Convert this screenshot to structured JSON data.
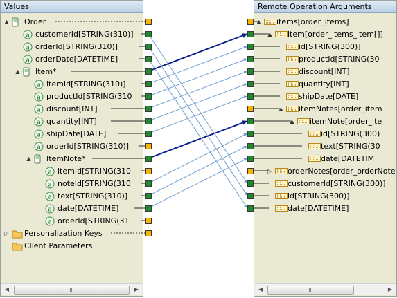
{
  "left": {
    "title": "Values",
    "rows": [
      {
        "label": "Order",
        "expander": "▲",
        "icon": "phone-icon",
        "port": "o",
        "dash": true
      },
      {
        "label": "customerId[STRING(310)]",
        "icon": "attribute-icon",
        "port": "g"
      },
      {
        "label": "orderId[STRING(310)]",
        "icon": "attribute-icon",
        "port": "g"
      },
      {
        "label": "orderDate[DATETIME]",
        "icon": "attribute-icon",
        "port": "g"
      },
      {
        "label": "Item*",
        "expander": "▲",
        "icon": "phone-icon",
        "port": "g"
      },
      {
        "label": "itemId[STRING(310)]",
        "icon": "attribute-icon",
        "port": "g"
      },
      {
        "label": "productId[STRING(310",
        "icon": "attribute-icon",
        "port": "g"
      },
      {
        "label": "discount[INT]",
        "icon": "attribute-icon",
        "port": "g"
      },
      {
        "label": "quantity[INT]",
        "icon": "attribute-icon",
        "port": "g"
      },
      {
        "label": "shipDate[DATE]",
        "icon": "attribute-icon",
        "port": "g"
      },
      {
        "label": "orderId[STRING(310)]",
        "icon": "attribute-icon",
        "port": "o"
      },
      {
        "label": "ItemNote*",
        "expander": "▲",
        "icon": "phone-icon",
        "port": "g"
      },
      {
        "label": "itemId[STRING(310",
        "icon": "attribute-icon",
        "port": "o"
      },
      {
        "label": "noteId[STRING(310",
        "icon": "attribute-icon",
        "port": "g"
      },
      {
        "label": "text[STRING(310)]",
        "icon": "attribute-icon",
        "port": "g"
      },
      {
        "label": "date[DATETIME]",
        "icon": "attribute-icon",
        "port": "g"
      },
      {
        "label": "orderId[STRING(31",
        "icon": "attribute-icon",
        "port": "o"
      },
      {
        "label": "Personalization Keys",
        "expander": "▷",
        "icon": "folder-icon",
        "port": "o",
        "dash": true
      },
      {
        "label": "Client Parameters",
        "icon": "folder-icon"
      }
    ]
  },
  "right": {
    "title": "Remote Operation Arguments",
    "rows": [
      {
        "label": "items[order_items]",
        "expander": "▲",
        "icon": "field-icon",
        "port": "o"
      },
      {
        "label": "item[order_items_item[]]",
        "expander": "▲",
        "icon": "field-icon",
        "port": "g"
      },
      {
        "label": "id[STRING(300)]",
        "icon": "field-icon",
        "port": "g"
      },
      {
        "label": "productId[STRING(30",
        "icon": "field-icon",
        "port": "g"
      },
      {
        "label": "discount[INT]",
        "icon": "field-icon",
        "port": "g"
      },
      {
        "label": "quantity[INT]",
        "icon": "field-icon",
        "port": "g"
      },
      {
        "label": "shipDate[DATE]",
        "icon": "field-icon",
        "port": "g"
      },
      {
        "label": "itemNotes[order_item",
        "expander": "▲",
        "icon": "field-icon",
        "port": "o"
      },
      {
        "label": "itemNote[order_ite",
        "expander": "▲",
        "icon": "field-icon",
        "port": "g"
      },
      {
        "label": "id[STRING(300)",
        "icon": "field-icon",
        "port": "g"
      },
      {
        "label": "text[STRING(30",
        "icon": "field-icon",
        "port": "g"
      },
      {
        "label": "date[DATETIM",
        "icon": "field-icon",
        "port": "g"
      },
      {
        "label": "orderNotes[order_orderNotes",
        "expander": "▷",
        "icon": "field-icon",
        "port": "o"
      },
      {
        "label": "customerId[STRING(300)]",
        "icon": "field-icon",
        "port": "g"
      },
      {
        "label": "id[STRING(300)]",
        "icon": "field-icon",
        "port": "g"
      },
      {
        "label": "date[DATETIME]",
        "icon": "field-icon",
        "port": "g"
      }
    ]
  },
  "connections": [
    {
      "from": 4,
      "to": 1,
      "bold": true
    },
    {
      "from": 11,
      "to": 8,
      "bold": true
    },
    {
      "from": 1,
      "to": 13
    },
    {
      "from": 2,
      "to": 14
    },
    {
      "from": 3,
      "to": 15
    },
    {
      "from": 5,
      "to": 2
    },
    {
      "from": 6,
      "to": 3
    },
    {
      "from": 7,
      "to": 4
    },
    {
      "from": 8,
      "to": 5
    },
    {
      "from": 9,
      "to": 6
    },
    {
      "from": 13,
      "to": 9
    },
    {
      "from": 14,
      "to": 10
    },
    {
      "from": 15,
      "to": 11
    }
  ],
  "colors": {
    "panel_bg": "#eae9d4",
    "port_green": "#1e8a2b",
    "port_orange": "#f7b500",
    "line_thin": "#6f9fcf",
    "line_bold": "#0a1f8a"
  }
}
